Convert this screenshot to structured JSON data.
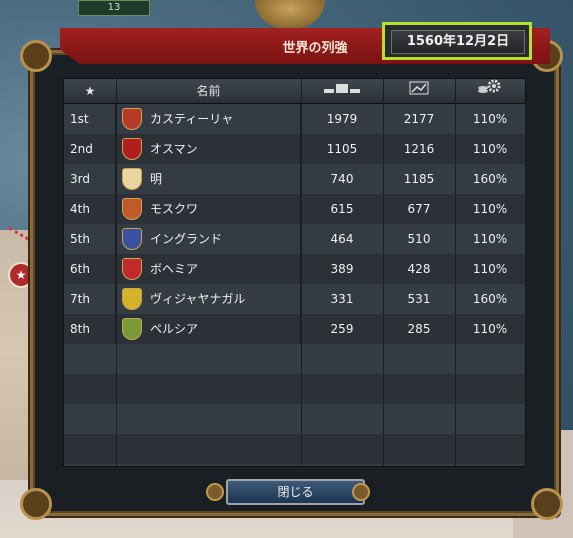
{
  "top_stub": {
    "text": "13"
  },
  "window": {
    "title": "世界の列強",
    "date": "1560年12月2日",
    "close_label": "閉じる"
  },
  "columns": [
    {
      "label": "★",
      "icon": "star-icon"
    },
    {
      "label": "名前"
    },
    {
      "label": "",
      "icon": "development-bars-icon"
    },
    {
      "label": "",
      "icon": "trend-chart-icon"
    },
    {
      "label": "",
      "icon": "coins-gear-icon"
    }
  ],
  "rows": [
    {
      "rank": "1st",
      "name": "カスティーリャ",
      "c1": "1979",
      "c2": "2177",
      "c3": "110%",
      "color": "#b53a2a"
    },
    {
      "rank": "2nd",
      "name": "オスマン",
      "c1": "1105",
      "c2": "1216",
      "c3": "110%",
      "color": "#b01e1e"
    },
    {
      "rank": "3rd",
      "name": "明",
      "c1": "740",
      "c2": "1185",
      "c3": "160%",
      "color": "#e8d7a0"
    },
    {
      "rank": "4th",
      "name": "モスクワ",
      "c1": "615",
      "c2": "677",
      "c3": "110%",
      "color": "#c05a2a"
    },
    {
      "rank": "5th",
      "name": "イングランド",
      "c1": "464",
      "c2": "510",
      "c3": "110%",
      "color": "#3a4fa0"
    },
    {
      "rank": "6th",
      "name": "ボヘミア",
      "c1": "389",
      "c2": "428",
      "c3": "110%",
      "color": "#c02a2a"
    },
    {
      "rank": "7th",
      "name": "ヴィジャヤナガル",
      "c1": "331",
      "c2": "531",
      "c3": "160%",
      "color": "#d4b22a"
    },
    {
      "rank": "8th",
      "name": "ペルシア",
      "c1": "259",
      "c2": "285",
      "c3": "110%",
      "color": "#7a9a3a"
    }
  ],
  "map": {
    "flag_symbol": "★"
  }
}
